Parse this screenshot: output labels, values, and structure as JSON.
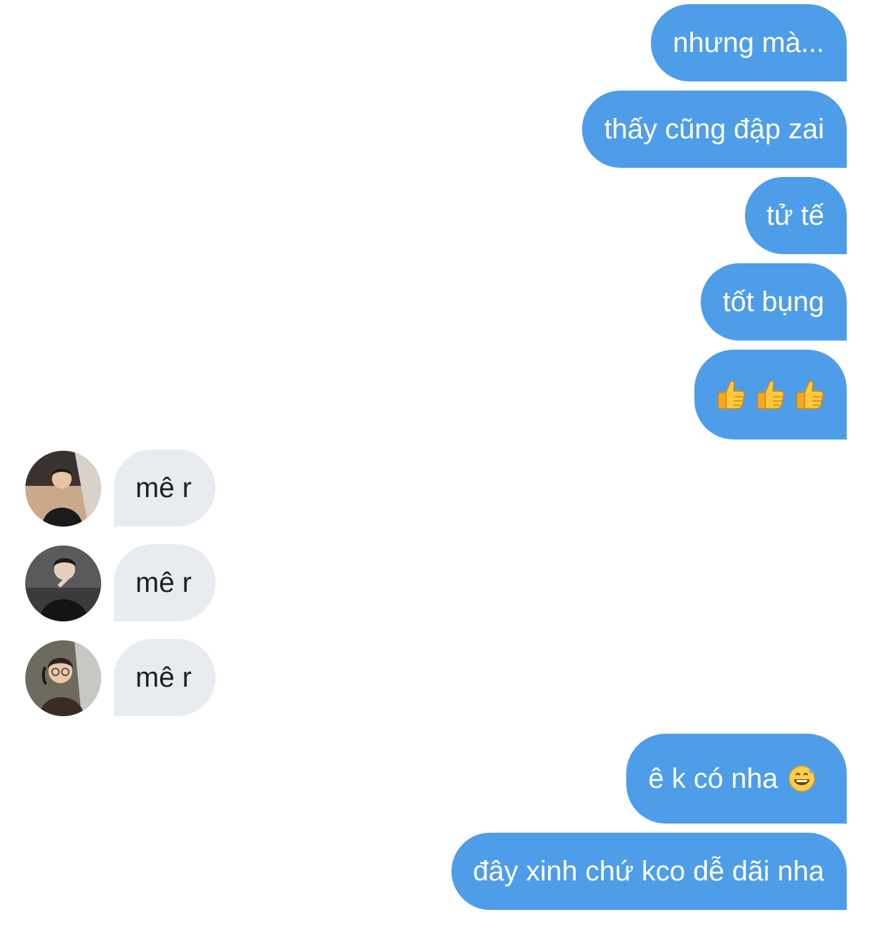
{
  "messages": [
    {
      "side": "out",
      "text": "nhưng mà..."
    },
    {
      "side": "out",
      "text": "thấy cũng đập zai"
    },
    {
      "side": "out",
      "text": "tử tế"
    },
    {
      "side": "out",
      "text": "tốt bụng"
    },
    {
      "side": "out",
      "emoji": [
        "thumbs-up-icon",
        "thumbs-up-icon",
        "thumbs-up-icon"
      ]
    },
    {
      "side": "in",
      "text": "mê r"
    },
    {
      "side": "in",
      "text": "mê r"
    },
    {
      "side": "in",
      "text": "mê r"
    },
    {
      "side": "out",
      "text": "ê k có nha",
      "emoji": [
        "grinning-sweat-icon"
      ]
    },
    {
      "side": "out",
      "text": "đây xinh chứ kco dễ dãi nha"
    }
  ],
  "colors": {
    "outgoing_bubble": "#4e9de9",
    "incoming_bubble": "#e8ebf0"
  }
}
